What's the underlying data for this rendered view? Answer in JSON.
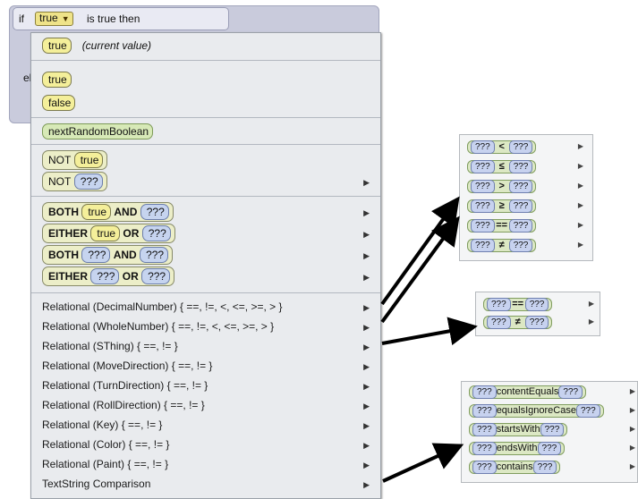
{
  "editor": {
    "if_word": "if",
    "condition_value": "true",
    "condition_tail": "is true then",
    "else_fragment": "el"
  },
  "menu": {
    "current_value": "true",
    "current_value_note": "(current value)",
    "literal_true": "true",
    "literal_false": "false",
    "random": "nextRandomBoolean",
    "not_true_kw": "NOT",
    "not_true_val": "true",
    "not_unknown_kw": "NOT",
    "not_unknown_val": "???",
    "both_true": {
      "kw1": "BOTH",
      "a": "true",
      "kw2": "AND",
      "b": "???"
    },
    "either_true": {
      "kw1": "EITHER",
      "a": "true",
      "kw2": "OR",
      "b": "???"
    },
    "both_unknown": {
      "kw1": "BOTH",
      "a": "???",
      "kw2": "AND",
      "b": "???"
    },
    "either_unknown": {
      "kw1": "EITHER",
      "a": "???",
      "kw2": "OR",
      "b": "???"
    },
    "relational": [
      "Relational (DecimalNumber) { ==, !=, <, <=, >=, > }",
      "Relational (WholeNumber) { ==, !=, <, <=, >=, > }",
      "Relational (SThing) { ==, != }",
      "Relational (MoveDirection) { ==, != }",
      "Relational (TurnDirection) { ==, != }",
      "Relational (RollDirection) { ==, != }",
      "Relational (Key) { ==, != }",
      "Relational (Color) { ==, != }",
      "Relational (Paint) { ==, != }",
      "TextString Comparison"
    ]
  },
  "panel_numeric": {
    "operand": "???",
    "ops": [
      "<",
      "≤",
      ">",
      "≥",
      "==",
      "≠"
    ]
  },
  "panel_equality": {
    "operand": "???",
    "ops": [
      "==",
      "≠"
    ]
  },
  "panel_text": {
    "operand": "???",
    "ops": [
      "contentEquals",
      "equalsIgnoreCase",
      "startsWith",
      "endsWith",
      "contains"
    ]
  }
}
